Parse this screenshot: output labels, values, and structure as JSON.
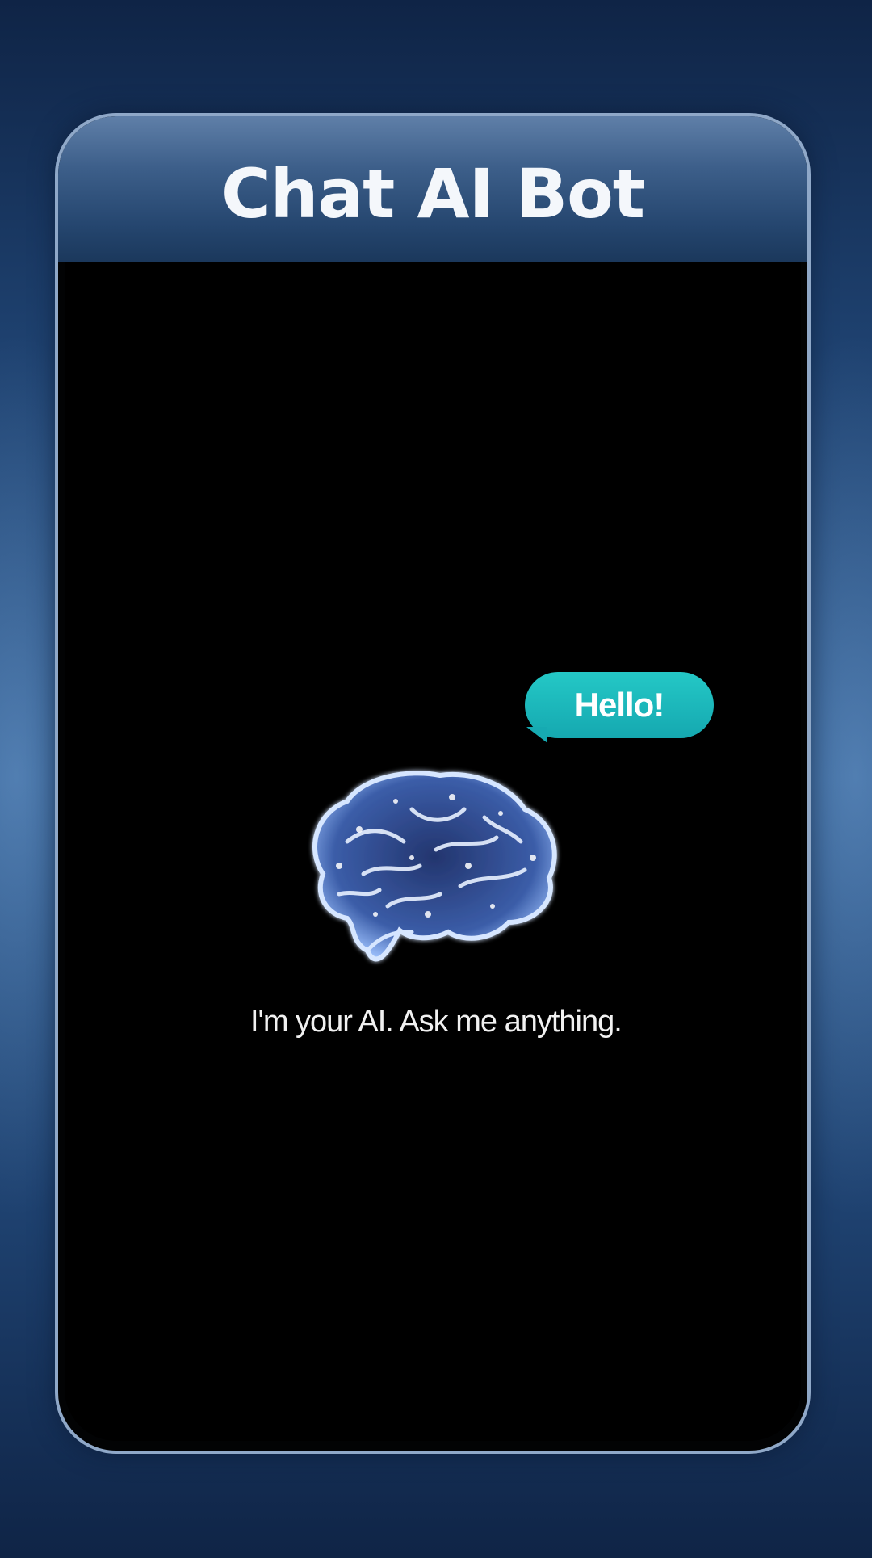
{
  "app": {
    "title": "Chat AI Bot"
  },
  "chat": {
    "bubble_text": "Hello!",
    "tagline": "I'm your AI. Ask me anything."
  },
  "icons": {
    "brain": "brain-icon"
  },
  "colors": {
    "background": "#1e416f",
    "header": "#3d5f8a",
    "screen": "#000000",
    "bubble": "#1bb8bb",
    "brain_glow": "#9fc3ff"
  }
}
